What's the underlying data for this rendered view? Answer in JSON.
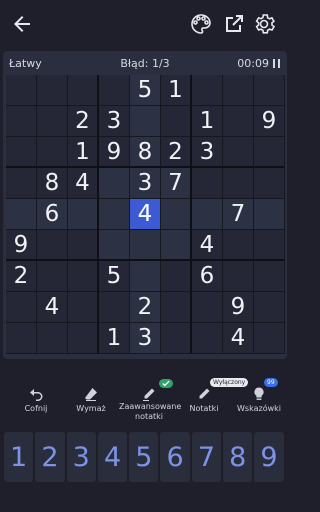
{
  "header": {
    "back_icon": "arrow-left-icon",
    "theme_icon": "palette-icon",
    "share_icon": "external-link-icon",
    "settings_icon": "gear-icon"
  },
  "status": {
    "difficulty": "Łatwy",
    "mistakes": "Błąd: 1/3",
    "timer": "00:09"
  },
  "board": {
    "rows": [
      [
        "",
        "",
        "",
        "",
        "5",
        "1",
        "",
        "",
        ""
      ],
      [
        "",
        "",
        "2",
        "3",
        "",
        "",
        "1",
        "",
        "9"
      ],
      [
        "",
        "",
        "1",
        "9",
        "8",
        "2",
        "3",
        "",
        ""
      ],
      [
        "",
        "8",
        "4",
        "",
        "3",
        "7",
        "",
        "",
        ""
      ],
      [
        "",
        "6",
        "",
        "",
        "4",
        "",
        "",
        "7",
        ""
      ],
      [
        "9",
        "",
        "",
        "",
        "",
        "",
        "4",
        "",
        ""
      ],
      [
        "2",
        "",
        "",
        "5",
        "",
        "",
        "6",
        "",
        ""
      ],
      [
        "",
        "4",
        "",
        "",
        "2",
        "",
        "",
        "9",
        ""
      ],
      [
        "",
        "",
        "",
        "1",
        "3",
        "",
        "",
        "4",
        ""
      ]
    ],
    "selected": {
      "row": 5,
      "col": 5
    },
    "colors": {
      "selected": "#3c5ad4",
      "highlight": "#2d3144"
    }
  },
  "tools": {
    "undo_label": "Cofnij",
    "erase_label": "Wymaż",
    "advanced_notes_label": "Zaawansowane notatki",
    "notes_label": "Notatki",
    "notes_badge": "Wyłączony",
    "hints_label": "Wskazówki",
    "hints_badge": "99",
    "advanced_notes_badge_icon": "check-icon"
  },
  "numpad": {
    "keys": [
      "1",
      "2",
      "3",
      "4",
      "5",
      "6",
      "7",
      "8",
      "9"
    ],
    "color": "#7d93e8"
  }
}
